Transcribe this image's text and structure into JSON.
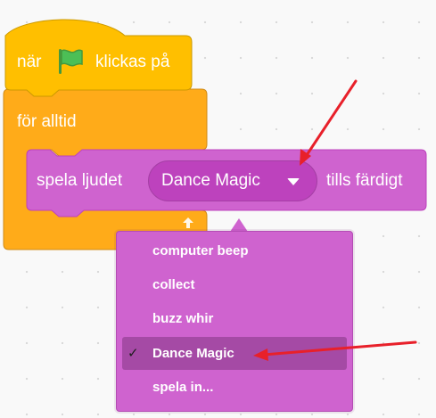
{
  "hat_block": {
    "text_before": "när",
    "icon": "green-flag-icon",
    "text_after": "klickas på",
    "color": "#FFBF00"
  },
  "forever_block": {
    "label": "för alltid",
    "color": "#FFAB19"
  },
  "play_sound_block": {
    "text_before": "spela ljudet",
    "selected_sound": "Dance Magic",
    "text_after": "tills färdigt",
    "color": "#CF63CF",
    "field_color": "#BD42BD"
  },
  "sound_menu": {
    "items": [
      {
        "label": "computer beep",
        "selected": false,
        "check": ""
      },
      {
        "label": "collect",
        "selected": false,
        "check": ""
      },
      {
        "label": "buzz whir",
        "selected": false,
        "check": ""
      },
      {
        "label": "Dance Magic",
        "selected": true,
        "check": "✓"
      },
      {
        "label": "spela in...",
        "selected": false,
        "check": ""
      }
    ],
    "color": "#CF63CF",
    "selected_color": "#A54AA5"
  },
  "annotation_color": "#E8202A"
}
